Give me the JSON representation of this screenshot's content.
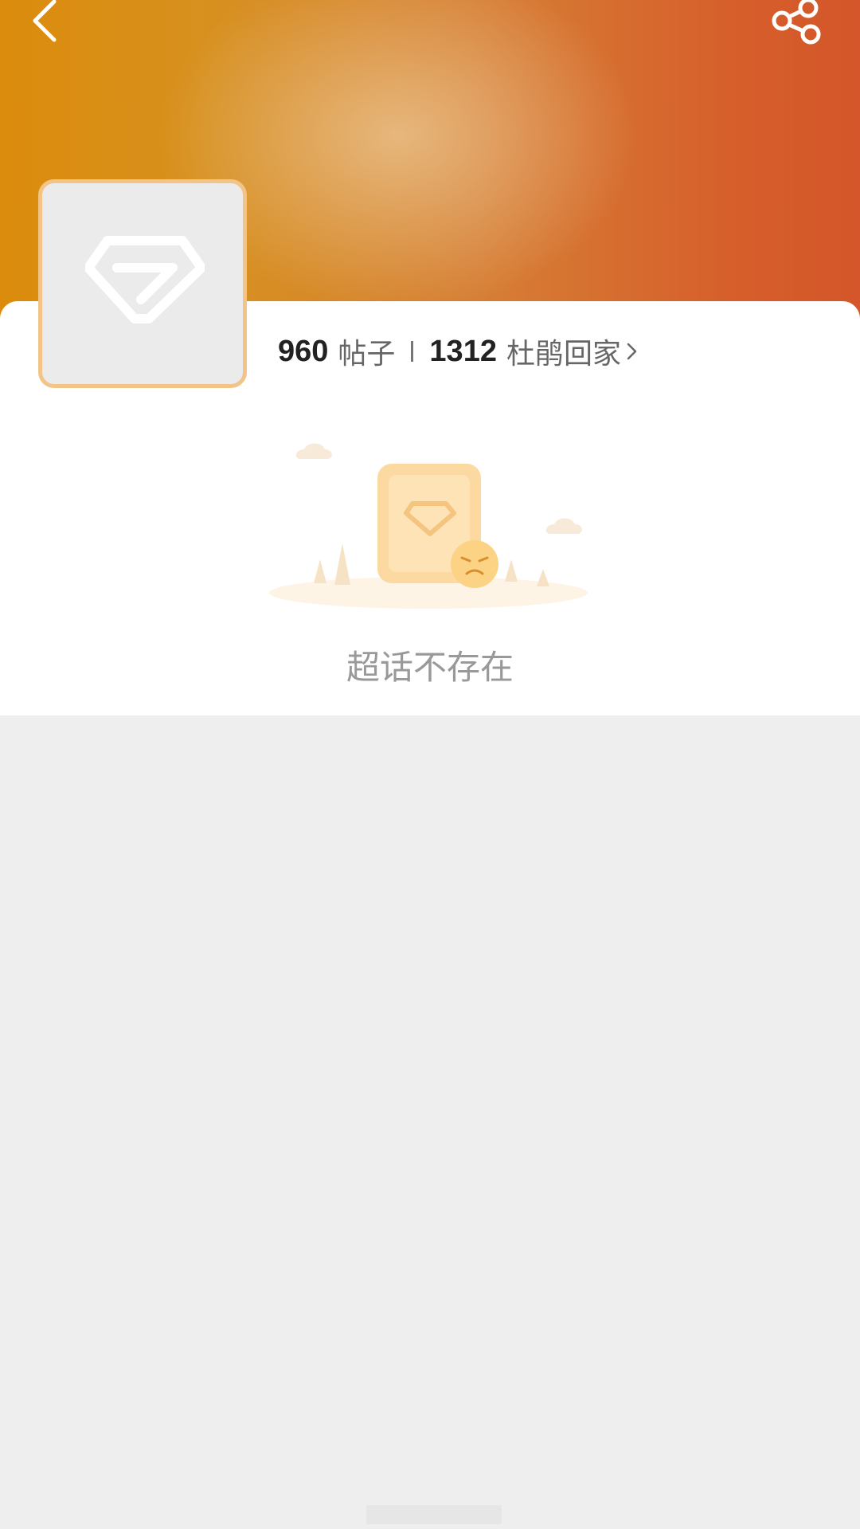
{
  "header": {
    "back_icon": "chevron-left-icon",
    "share_icon": "share-icon",
    "gradient_colors": [
      "#db8c0c",
      "#d67f35",
      "#d4562a"
    ]
  },
  "avatar": {
    "icon": "diamond-icon",
    "border_color": "#f2c487"
  },
  "stats": {
    "posts_count": "960",
    "posts_label": "帖子",
    "fans_count": "1312",
    "fans_label": "杜鹃回家"
  },
  "empty_state": {
    "illustration": "sad-document-icon",
    "message": "超话不存在"
  },
  "colors": {
    "accent": "#f2a93b",
    "background": "#eeeeee",
    "card": "#ffffff"
  }
}
